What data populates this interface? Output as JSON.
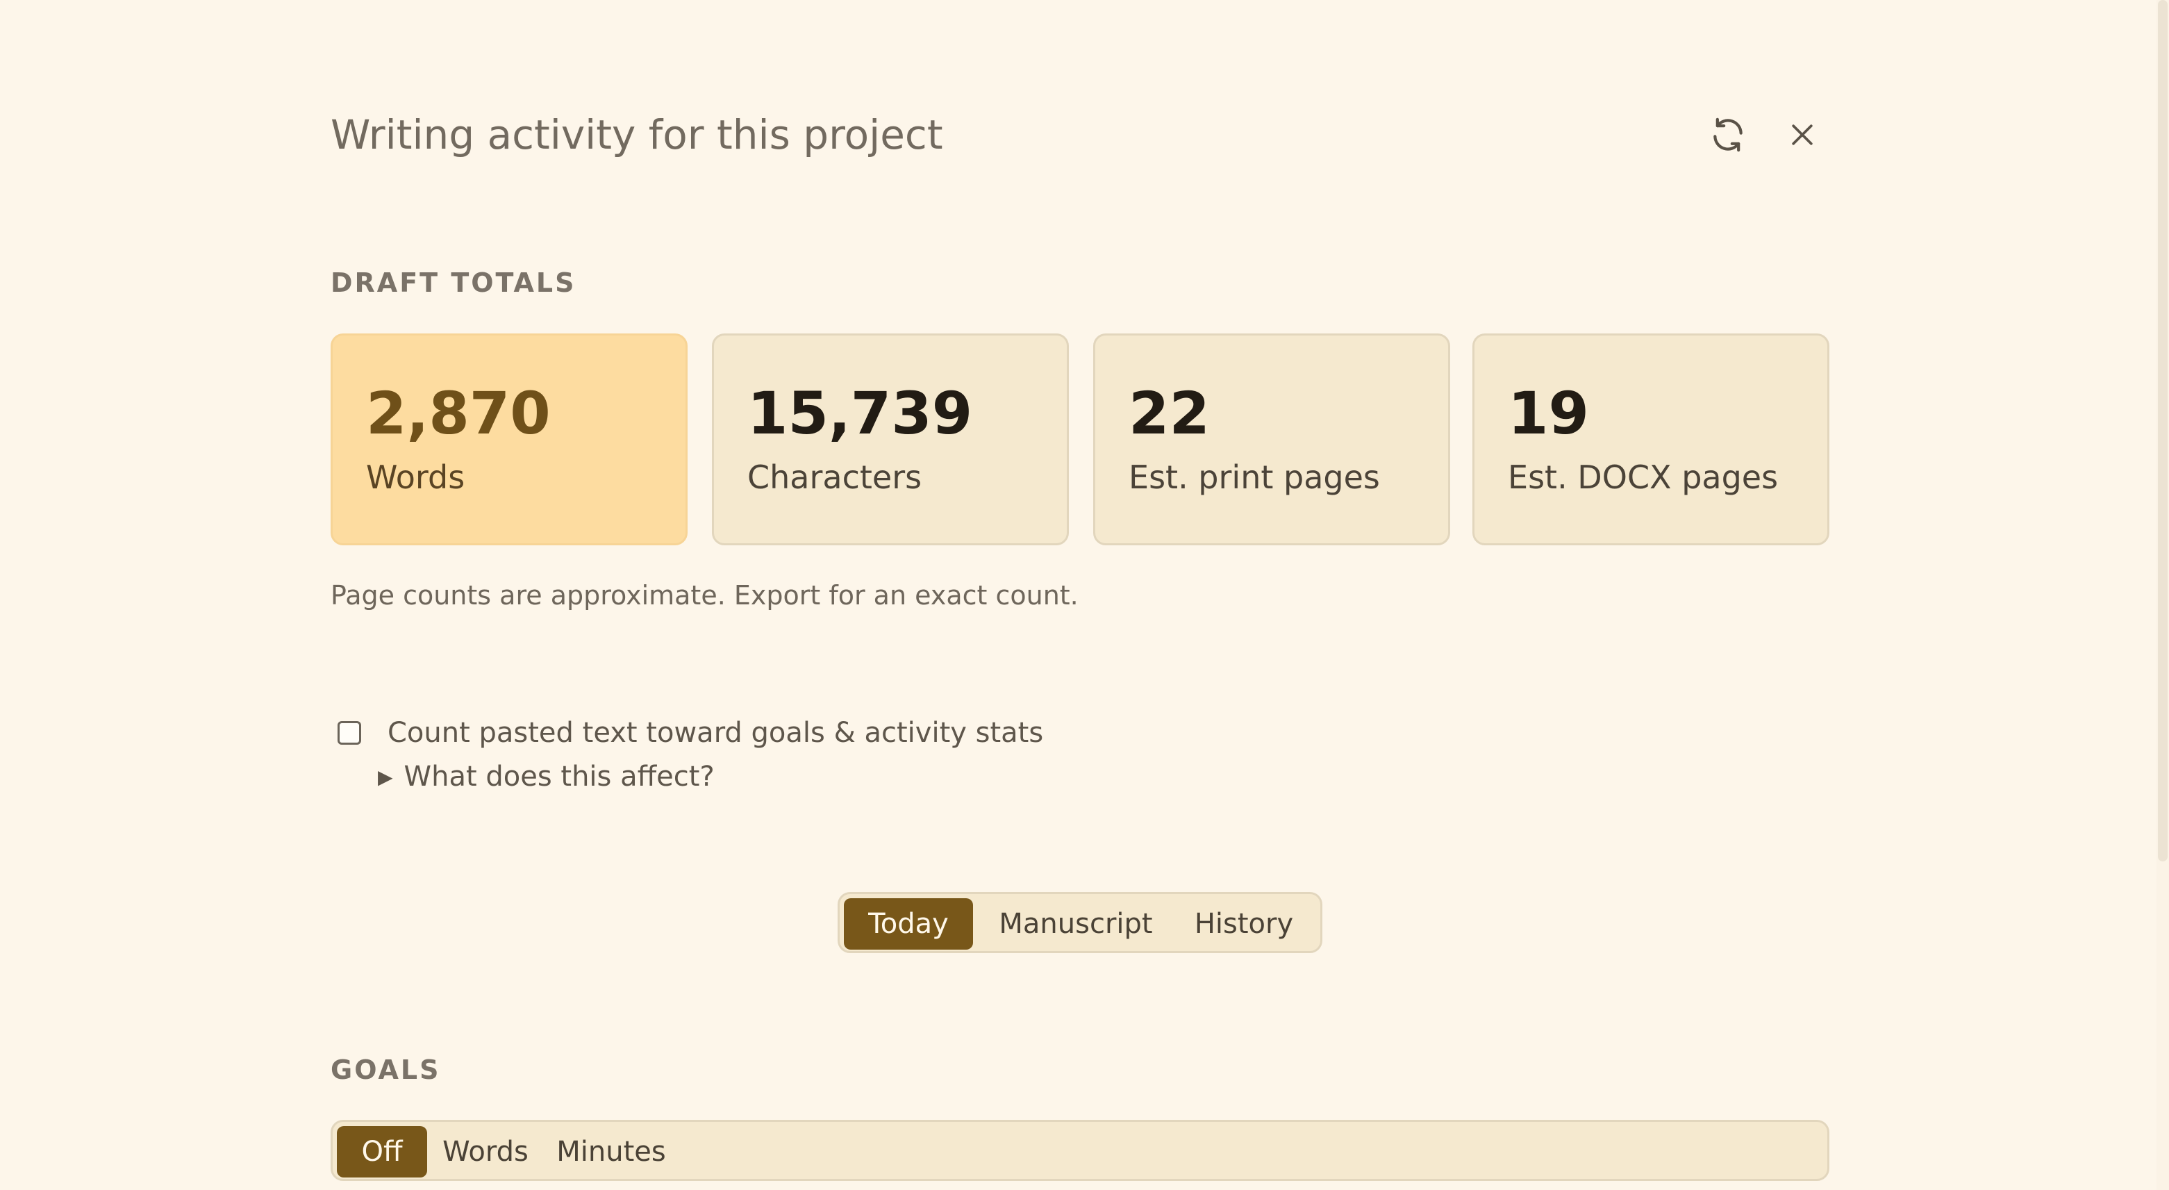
{
  "header": {
    "title": "Writing activity for this project",
    "refresh_icon": "refresh-icon",
    "close_icon": "close-icon"
  },
  "draft_totals": {
    "label": "DRAFT TOTALS",
    "cards": [
      {
        "value": "2,870",
        "label": "Words"
      },
      {
        "value": "15,739",
        "label": "Characters"
      },
      {
        "value": "22",
        "label": "Est. print pages"
      },
      {
        "value": "19",
        "label": "Est. DOCX pages"
      }
    ],
    "note": "Page counts are approximate. Export for an exact count."
  },
  "paste_option": {
    "label": "Count pasted text toward goals & activity stats",
    "checked": false,
    "disclosure": "What does this affect?"
  },
  "view_tabs": {
    "items": [
      "Today",
      "Manuscript",
      "History"
    ],
    "selected": "Today"
  },
  "goals": {
    "label": "GOALS",
    "options": [
      "Off",
      "Words",
      "Minutes"
    ],
    "selected": "Off"
  },
  "colors": {
    "background": "#fdf6ea",
    "accent": "#785719",
    "card_highlight": "#fddca0",
    "card": "#f5e9cf"
  }
}
